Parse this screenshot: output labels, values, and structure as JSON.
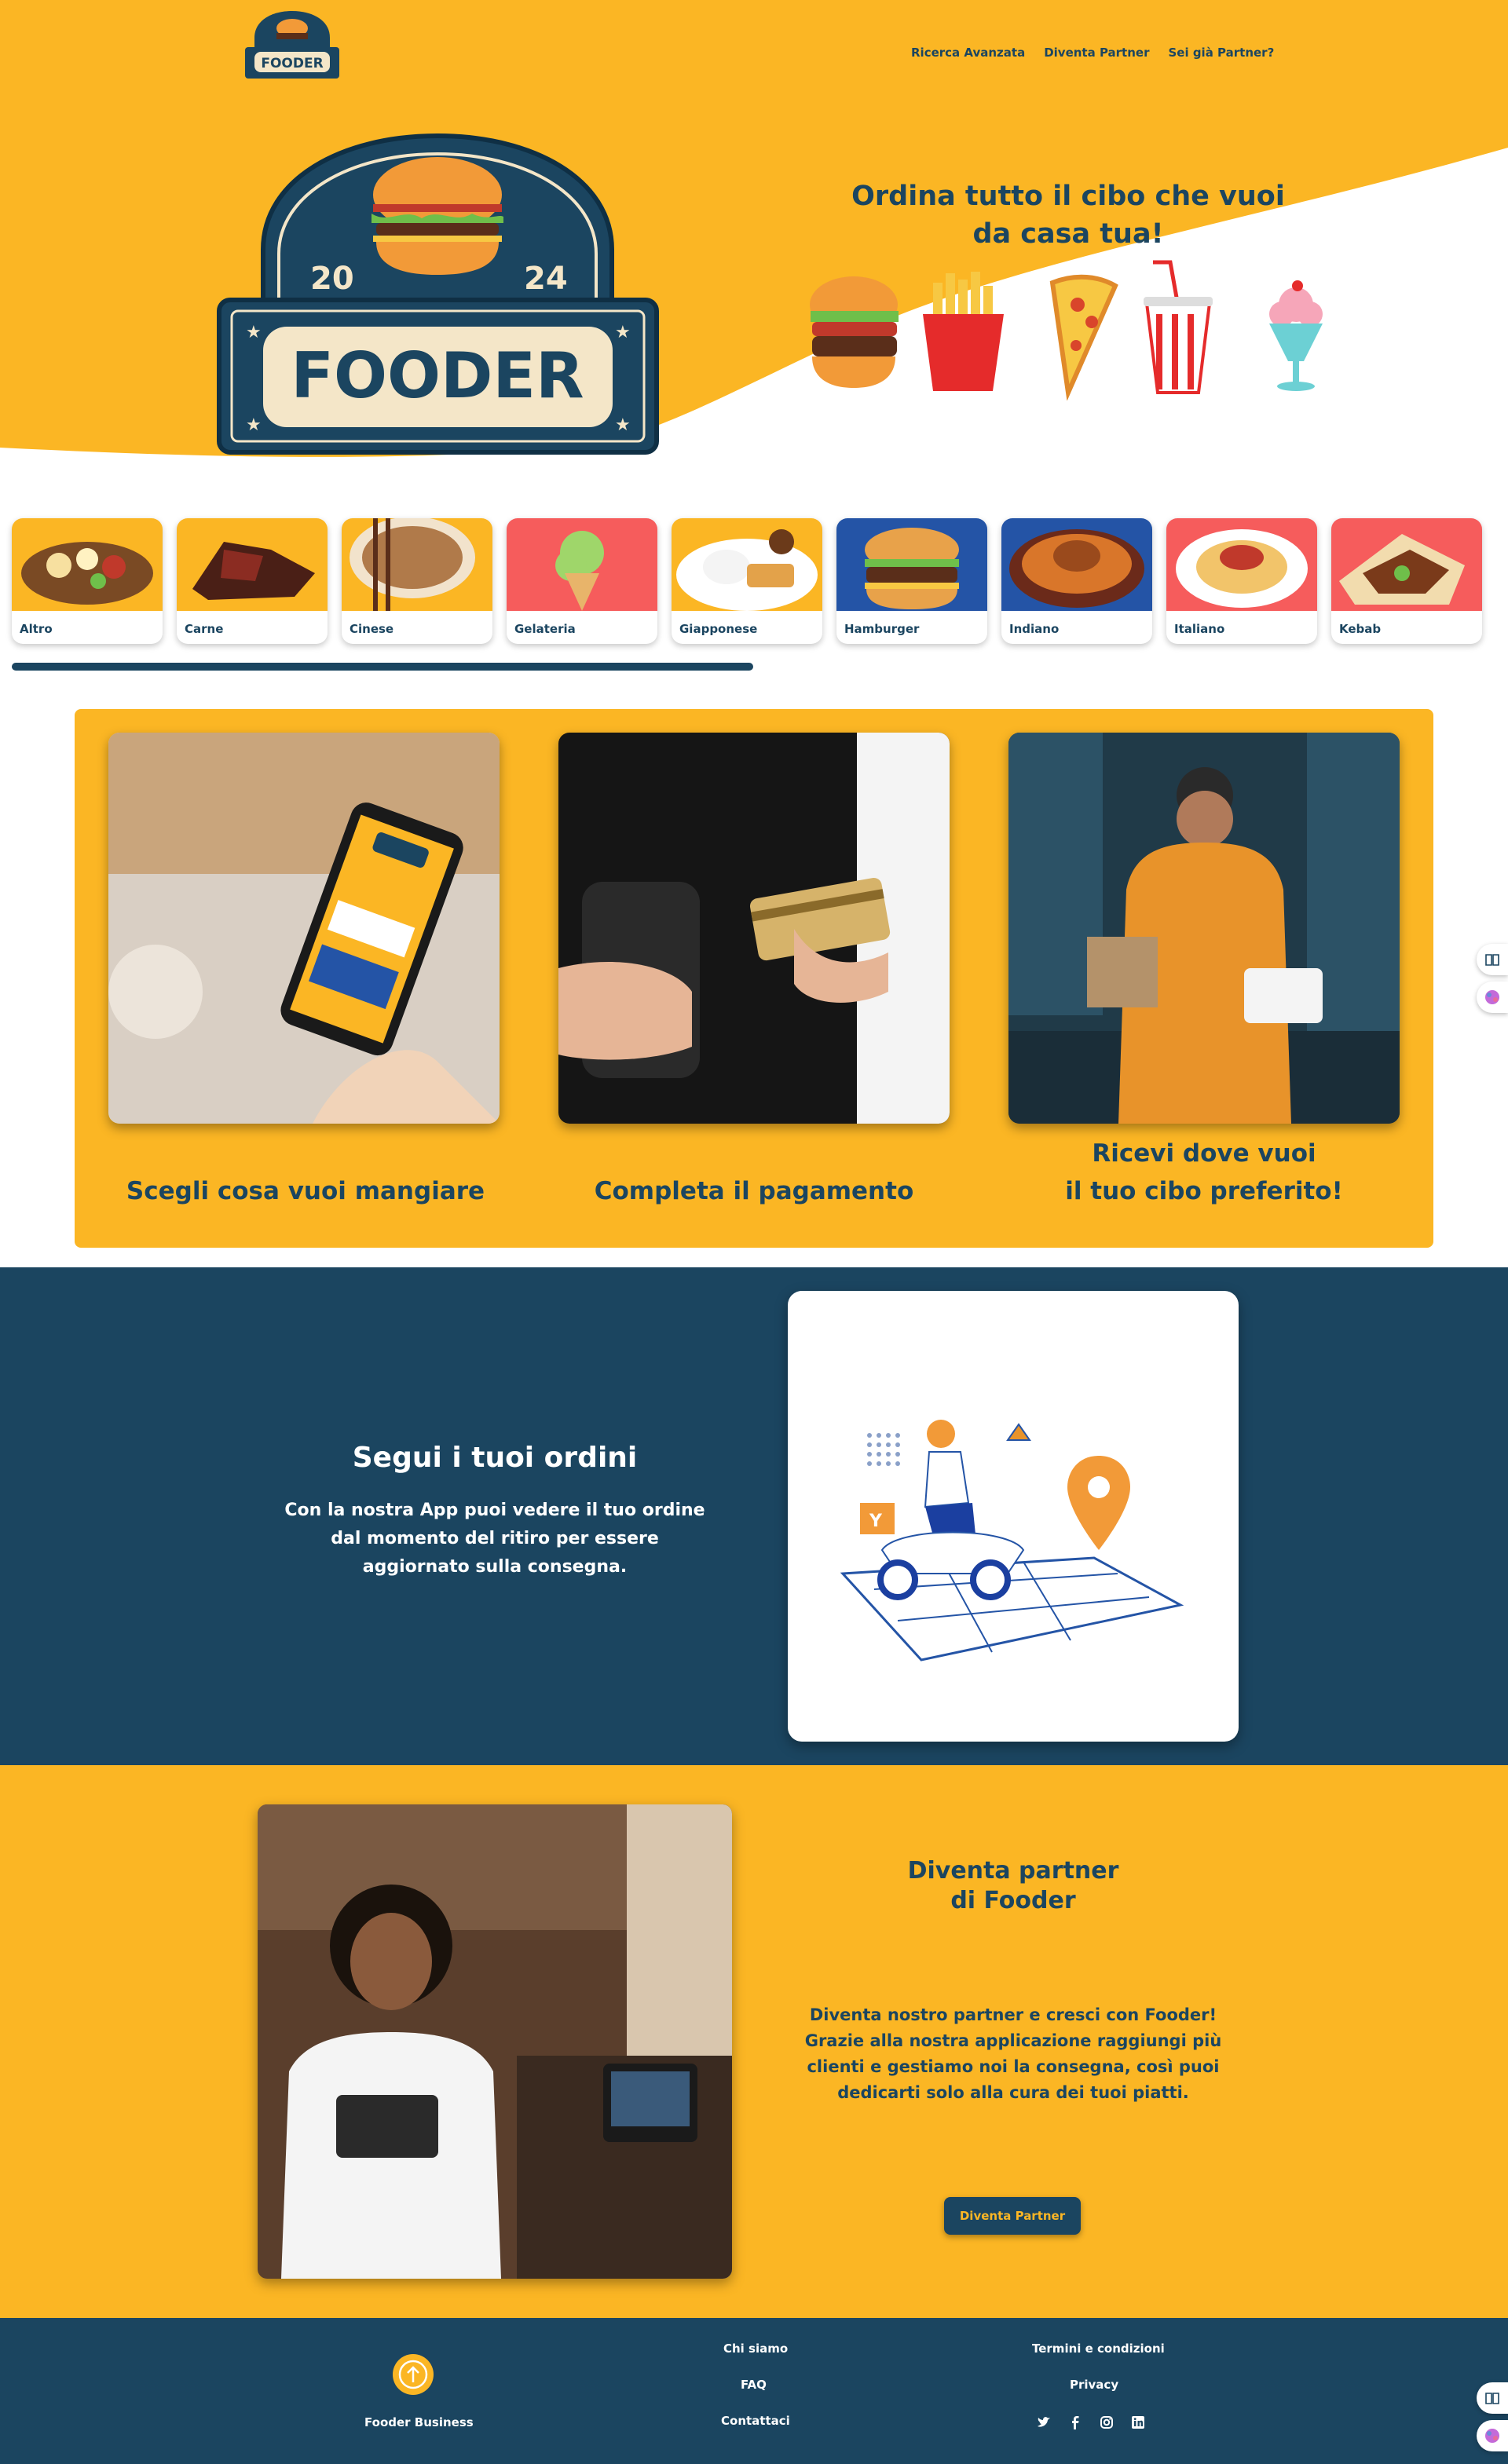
{
  "nav": {
    "logo_text": "FOODER",
    "links": [
      "Ricerca Avanzata",
      "Diventa Partner",
      "Sei già Partner?"
    ]
  },
  "hero": {
    "logo_text": "FOODER",
    "logo_year_left": "20",
    "logo_year_right": "24",
    "tagline_line1": "Ordina tutto il cibo che vuoi",
    "tagline_line2": "da casa tua!",
    "food_icons": [
      "burger-icon",
      "fries-icon",
      "pizza-icon",
      "soda-icon",
      "milkshake-icon"
    ]
  },
  "categories": [
    {
      "label": "Altro",
      "bg": "#fbb624"
    },
    {
      "label": "Carne",
      "bg": "#fbb624"
    },
    {
      "label": "Cinese",
      "bg": "#fbb624"
    },
    {
      "label": "Gelateria",
      "bg": "#f65c5c"
    },
    {
      "label": "Giapponese",
      "bg": "#fbb624"
    },
    {
      "label": "Hamburger",
      "bg": "#2454a6"
    },
    {
      "label": "Indiano",
      "bg": "#2454a6"
    },
    {
      "label": "Italiano",
      "bg": "#f65c5c"
    },
    {
      "label": "Kebab",
      "bg": "#f65c5c"
    }
  ],
  "steps": [
    {
      "caption": "Scegli cosa vuoi mangiare"
    },
    {
      "caption": "Completa il pagamento"
    },
    {
      "caption_line1": "Ricevi dove vuoi",
      "caption_line2": "il tuo cibo preferito!"
    }
  ],
  "tracking": {
    "title": "Segui i tuoi ordini",
    "text": "Con la nostra App puoi vedere il tuo ordine dal momento del ritiro per essere aggiornato sulla consegna."
  },
  "partner": {
    "title_line1": "Diventa partner",
    "title_line2": "di Fooder",
    "text_line1": "Diventa nostro partner e cresci con Fooder!",
    "text_line2": "Grazie alla nostra applicazione raggiungi più clienti e gestiamo noi la consegna, così puoi dedicarti solo alla cura dei tuoi piatti.",
    "button": "Diventa Partner"
  },
  "footer": {
    "business": "Fooder Business",
    "chi_siamo": "Chi siamo",
    "faq": "FAQ",
    "contattaci": "Contattaci",
    "termini": "Termini e condizioni",
    "privacy": "Privacy",
    "socials": [
      "twitter-icon",
      "facebook-icon",
      "instagram-icon",
      "linkedin-icon"
    ]
  },
  "colors": {
    "brand_yellow": "#fbb624",
    "brand_navy": "#1b4560",
    "white": "#ffffff"
  }
}
